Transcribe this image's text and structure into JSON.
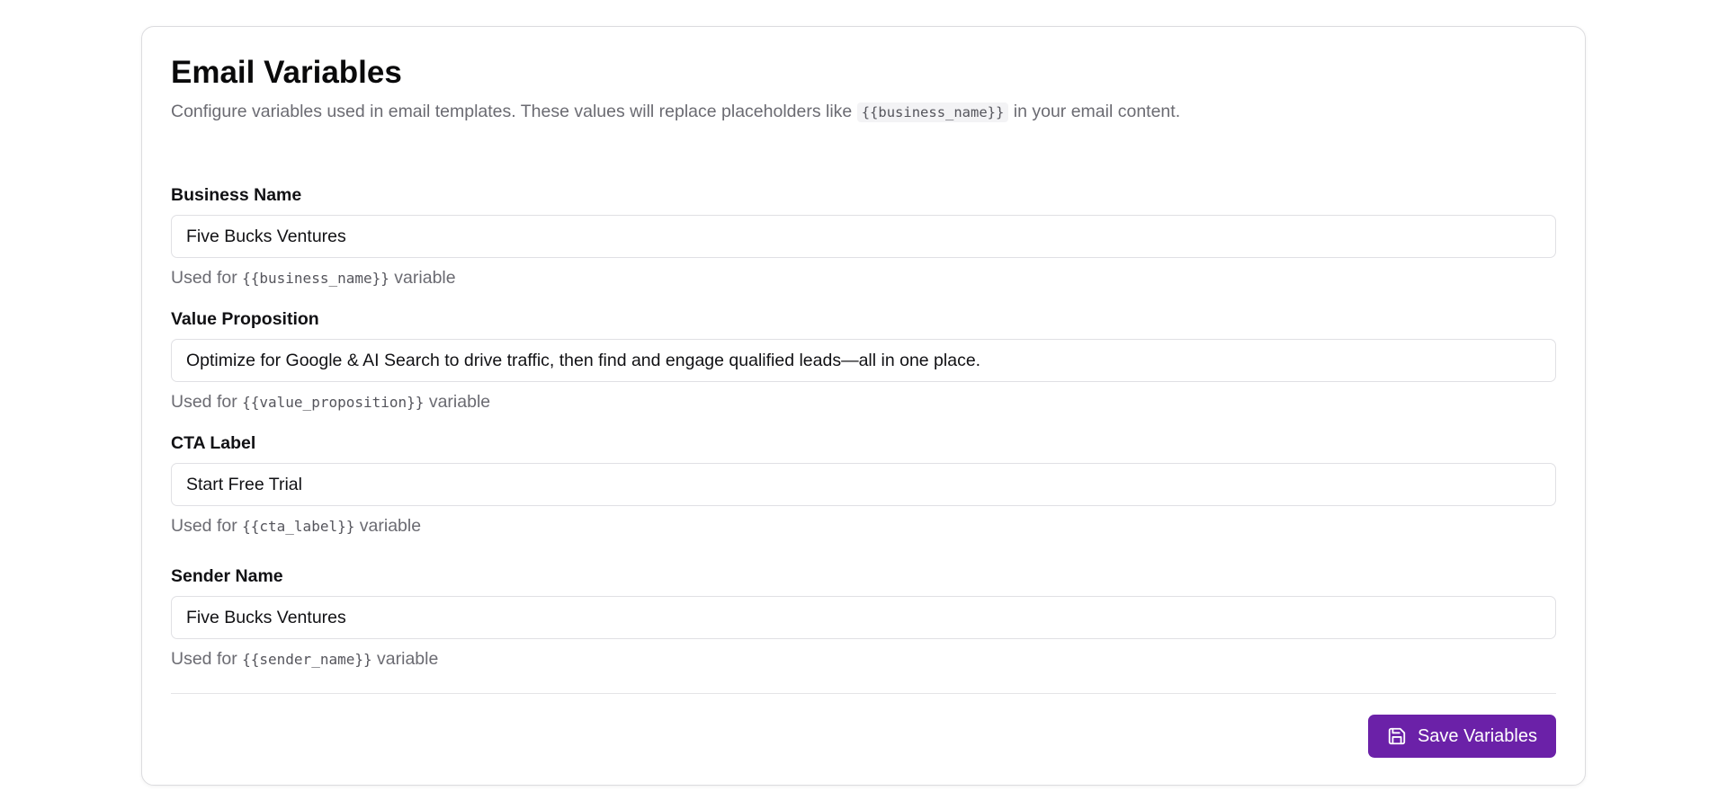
{
  "header": {
    "title": "Email Variables",
    "subtitle_before": "Configure variables used in email templates. These values will replace placeholders like ",
    "subtitle_code": "{{business_name}}",
    "subtitle_after": " in your email content."
  },
  "fields": [
    {
      "label": "Business Name",
      "value": "Five Bucks Ventures",
      "help_prefix": "Used for ",
      "help_code": "{{business_name}}",
      "help_suffix": " variable"
    },
    {
      "label": "Value Proposition",
      "value": "Optimize for Google & AI Search to drive traffic, then find and engage qualified leads—all in one place.",
      "help_prefix": "Used for ",
      "help_code": "{{value_proposition}}",
      "help_suffix": " variable"
    },
    {
      "label": "CTA Label",
      "value": "Start Free Trial",
      "help_prefix": "Used for ",
      "help_code": "{{cta_label}}",
      "help_suffix": " variable"
    },
    {
      "label": "Sender Name",
      "value": "Five Bucks Ventures",
      "help_prefix": "Used for ",
      "help_code": "{{sender_name}}",
      "help_suffix": " variable"
    }
  ],
  "actions": {
    "save_label": "Save Variables",
    "save_icon": "save-icon"
  },
  "colors": {
    "accent": "#6b21a8",
    "muted_text": "#6b6b72",
    "border": "#e0e0e4"
  }
}
